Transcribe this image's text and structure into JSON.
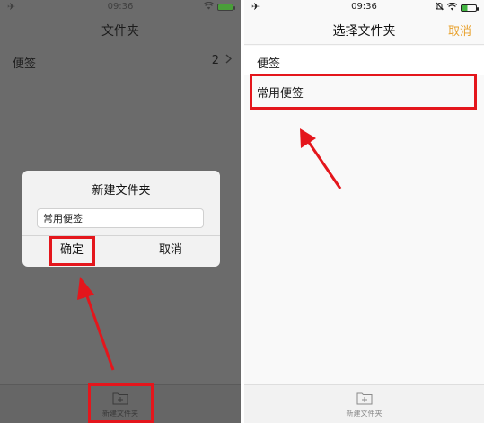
{
  "left_screen": {
    "status": {
      "time": "09:36"
    },
    "nav": {
      "title": "文件夹"
    },
    "folder_row": {
      "label": "便签",
      "count": "2"
    },
    "dialog": {
      "title": "新建文件夹",
      "input_value": "常用便签",
      "confirm_label": "确定",
      "cancel_label": "取消"
    },
    "bottom": {
      "new_folder_label": "新建文件夹"
    }
  },
  "right_screen": {
    "status": {
      "time": "09:36"
    },
    "nav": {
      "title": "选择文件夹",
      "cancel_label": "取消"
    },
    "folders": [
      {
        "label": "便签"
      },
      {
        "label": "常用便签"
      }
    ],
    "bottom": {
      "new_folder_label": "新建文件夹"
    }
  },
  "icons": {
    "airplane": "airplane-icon",
    "wifi": "wifi-icon",
    "battery": "battery-icon",
    "new_folder": "folder-plus-icon",
    "chevron": "chevron-right-icon"
  },
  "colors": {
    "annotation": "#e4161c",
    "accent": "#e8a02a",
    "dim_overlay": "#6b6b6b"
  }
}
